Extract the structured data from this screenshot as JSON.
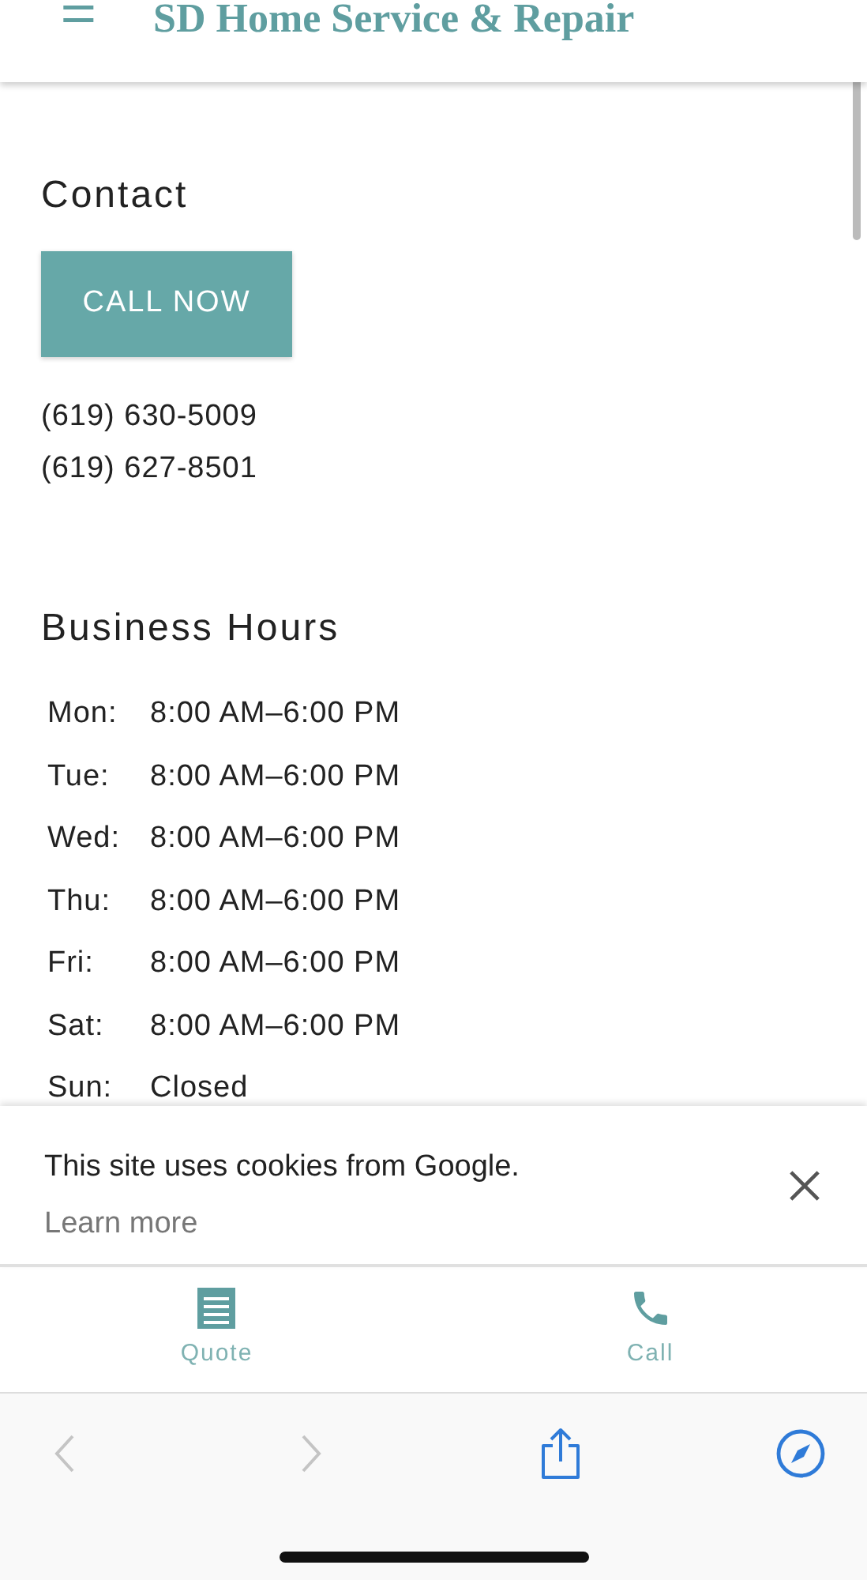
{
  "header": {
    "menu_icon": "☰",
    "title": "SD Home Service & Repair"
  },
  "contact": {
    "heading": "Contact",
    "button": "CALL NOW",
    "phones": [
      "(619) 630-5009",
      "(619) 627-8501"
    ]
  },
  "business_hours": {
    "heading": "Business Hours",
    "rows": [
      {
        "day": "Mon:",
        "hours": "8:00 AM–6:00 PM"
      },
      {
        "day": "Tue:",
        "hours": "8:00 AM–6:00 PM"
      },
      {
        "day": "Wed:",
        "hours": "8:00 AM–6:00 PM"
      },
      {
        "day": "Thu:",
        "hours": "8:00 AM–6:00 PM"
      },
      {
        "day": "Fri:",
        "hours": "8:00 AM–6:00 PM"
      },
      {
        "day": "Sat:",
        "hours": "8:00 AM–6:00 PM"
      },
      {
        "day": "Sun:",
        "hours": "Closed"
      }
    ]
  },
  "cookie_banner": {
    "message": "This site uses cookies from Google.",
    "link": "Learn more"
  },
  "bottom_nav": [
    {
      "kind": "quote",
      "label": "Quote"
    },
    {
      "kind": "call",
      "label": "Call"
    }
  ],
  "browser_toolbar": [
    {
      "kind": "back",
      "disabled": true
    },
    {
      "kind": "forward",
      "disabled": true
    },
    {
      "kind": "share",
      "disabled": false
    },
    {
      "kind": "compass",
      "disabled": false
    }
  ]
}
